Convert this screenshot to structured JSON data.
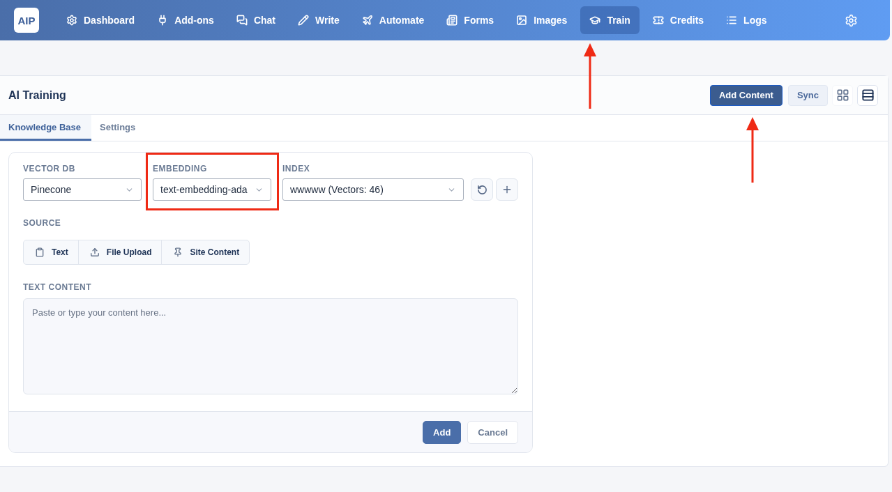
{
  "nav": {
    "logo": "AIP",
    "items": [
      {
        "label": "Dashboard",
        "selected": false
      },
      {
        "label": "Add-ons",
        "selected": false
      },
      {
        "label": "Chat",
        "selected": false
      },
      {
        "label": "Write",
        "selected": false
      },
      {
        "label": "Automate",
        "selected": false
      },
      {
        "label": "Forms",
        "selected": false
      },
      {
        "label": "Images",
        "selected": false
      },
      {
        "label": "Train",
        "selected": true
      },
      {
        "label": "Credits",
        "selected": false
      },
      {
        "label": "Logs",
        "selected": false
      }
    ]
  },
  "page": {
    "title": "AI Training",
    "actions": [
      {
        "label": "Add Content",
        "kind": "primary"
      },
      {
        "label": "Sync",
        "kind": "secondary"
      }
    ],
    "views": [
      {
        "kind": "grid",
        "selected": false
      },
      {
        "kind": "list",
        "selected": true
      }
    ]
  },
  "tabs": [
    {
      "label": "Knowledge Base",
      "selected": true
    },
    {
      "label": "Settings",
      "selected": false
    }
  ],
  "form": {
    "selects": [
      {
        "label": "VECTOR DB",
        "value": "Pinecone"
      },
      {
        "label": "EMBEDDING",
        "value": "text-embedding-ada"
      },
      {
        "label": "INDEX",
        "value": "wwwww (Vectors: 46)"
      }
    ],
    "source_label": "SOURCE",
    "sources": [
      {
        "label": "Text"
      },
      {
        "label": "File Upload"
      },
      {
        "label": "Site Content"
      }
    ],
    "content_label": "TEXT CONTENT",
    "content_placeholder": "Paste or type your content here...",
    "buttons": [
      {
        "label": "Add",
        "kind": "primary"
      },
      {
        "label": "Cancel",
        "kind": "secondary"
      }
    ]
  },
  "annotations": [
    {
      "kind": "arrow"
    },
    {
      "kind": "arrow"
    },
    {
      "kind": "box"
    }
  ]
}
